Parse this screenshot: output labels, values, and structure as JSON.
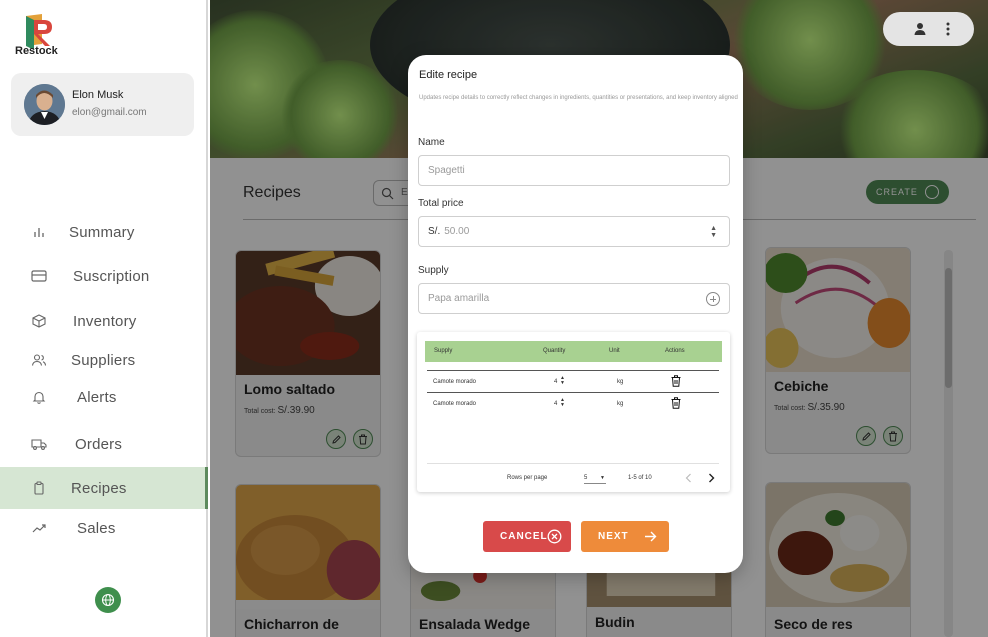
{
  "app": {
    "name": "Restock"
  },
  "profile": {
    "name": "Elon Musk",
    "email": "elon@gmail.com"
  },
  "nav": {
    "items": [
      {
        "label": "Summary"
      },
      {
        "label": "Suscription"
      },
      {
        "label": "Inventory"
      },
      {
        "label": "Suppliers"
      },
      {
        "label": "Alerts"
      },
      {
        "label": "Orders"
      },
      {
        "label": "Recipes"
      },
      {
        "label": "Sales"
      }
    ],
    "active": "Recipes"
  },
  "page": {
    "title": "Recipes",
    "search_placeholder": "E",
    "create_label": "CREATE"
  },
  "cards": [
    {
      "title": "Lomo saltado",
      "cost_label": "Total cost:",
      "cost_value": "S/.39.90"
    },
    {
      "title": "Cebiche",
      "cost_label": "Total cost:",
      "cost_value": "S/.35.90"
    },
    {
      "title": "Chicharron de"
    },
    {
      "title": "Ensalada Wedge"
    },
    {
      "title": "Budin"
    },
    {
      "title": "Seco de res"
    }
  ],
  "modal": {
    "title": "Edite recipe",
    "description": "Updates recipe details to correctly reflect changes in ingredients, quantities or presentations, and keep inventory aligned",
    "name_label": "Name",
    "name_placeholder": "Spagetti",
    "price_label": "Total price",
    "price_prefix": "S/.",
    "price_value": "50.00",
    "supply_label": "Supply",
    "supply_placeholder": "Papa amarilla",
    "table": {
      "headers": [
        "Supply",
        "Quantity",
        "Unit",
        "Actions"
      ],
      "rows": [
        {
          "supply": "Camote morado",
          "quantity": "4",
          "unit": "kg"
        },
        {
          "supply": "Camote morado",
          "quantity": "4",
          "unit": "kg"
        }
      ],
      "rows_per_page_label": "Rows per page",
      "rows_per_page_value": "5",
      "range_label": "1-5 of 10"
    },
    "cancel_label": "CANCEL",
    "next_label": "NEXT"
  },
  "colors": {
    "brand_green": "#4f8a55",
    "active_nav_bg": "#d6e6d3",
    "table_header": "#a8d191",
    "cancel": "#d84a4a",
    "next": "#ee8b3a"
  }
}
